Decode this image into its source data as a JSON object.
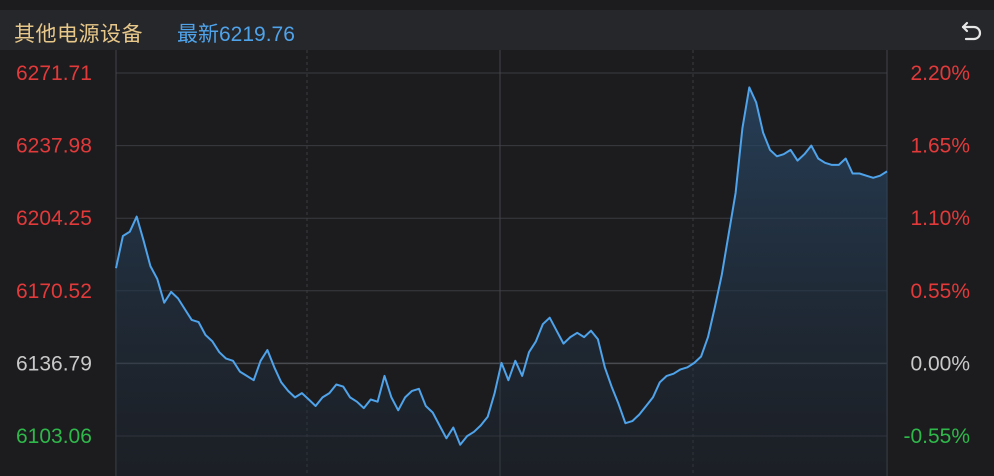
{
  "header": {
    "title": "其他电源设备",
    "latest_label": "最新",
    "latest_value": "6219.76",
    "back_icon": "undo-arrow-icon"
  },
  "colors": {
    "up": "#e23a3a",
    "down": "#2fb84a",
    "neutral": "#c9c9c9",
    "line": "#4fa3ea",
    "title": "#e8c88a",
    "background": "#1c1c1f",
    "grid": "#3a3b40"
  },
  "chart_data": {
    "type": "line",
    "title": "",
    "xlabel": "",
    "ylabel": "",
    "ylim": [
      6094.0,
      6271.71
    ],
    "base_value": 6136.79,
    "left_ticks": [
      {
        "label": "6271.71",
        "value": 6271.71,
        "tone": "up"
      },
      {
        "label": "6237.98",
        "value": 6237.98,
        "tone": "up"
      },
      {
        "label": "6204.25",
        "value": 6204.25,
        "tone": "up"
      },
      {
        "label": "6170.52",
        "value": 6170.52,
        "tone": "up"
      },
      {
        "label": "6136.79",
        "value": 6136.79,
        "tone": "neutral"
      },
      {
        "label": "6103.06",
        "value": 6103.06,
        "tone": "down"
      }
    ],
    "right_ticks": [
      {
        "label": "2.20%",
        "value": 6271.71,
        "tone": "up"
      },
      {
        "label": "1.65%",
        "value": 6237.98,
        "tone": "up"
      },
      {
        "label": "1.10%",
        "value": 6204.25,
        "tone": "up"
      },
      {
        "label": "0.55%",
        "value": 6170.52,
        "tone": "up"
      },
      {
        "label": "0.00%",
        "value": 6136.79,
        "tone": "neutral"
      },
      {
        "label": "-0.55%",
        "value": 6103.06,
        "tone": "down"
      }
    ],
    "grid": true,
    "series": [
      {
        "values": [
          6181,
          6196,
          6198,
          6205,
          6194,
          6182,
          6176,
          6165,
          6170,
          6167,
          6162,
          6157,
          6156,
          6150,
          6147,
          6142,
          6139,
          6138,
          6133,
          6131,
          6129,
          6138,
          6143,
          6135,
          6128,
          6124,
          6121,
          6123,
          6120,
          6117,
          6121,
          6123,
          6127,
          6126,
          6121,
          6119,
          6116,
          6120,
          6119,
          6131,
          6121,
          6115,
          6121,
          6124,
          6125,
          6117,
          6114,
          6108,
          6102,
          6107,
          6099,
          6103,
          6105,
          6108,
          6112,
          6123,
          6137,
          6129,
          6138,
          6131,
          6142,
          6147,
          6155,
          6158,
          6152,
          6146,
          6149,
          6151,
          6149,
          6152,
          6148,
          6135,
          6126,
          6118,
          6109,
          6110,
          6113,
          6117,
          6121,
          6128,
          6131,
          6132,
          6134,
          6135,
          6137,
          6140,
          6149,
          6163,
          6178,
          6197,
          6216,
          6246,
          6265,
          6258,
          6244,
          6236,
          6233,
          6234,
          6236,
          6231,
          6234,
          6238,
          6232,
          6230,
          6229,
          6229,
          6232,
          6225,
          6225,
          6224,
          6223,
          6224,
          6226
        ]
      }
    ]
  }
}
